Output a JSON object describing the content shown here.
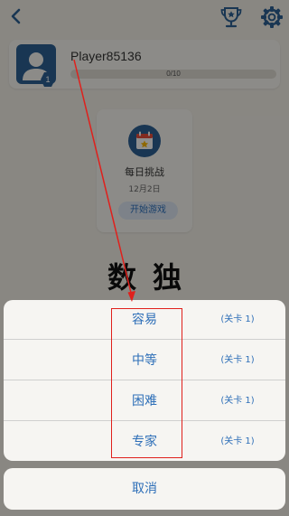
{
  "header": {
    "icons": [
      "back-icon",
      "trophy-icon",
      "gear-icon"
    ],
    "accent_color": "#2C5E8F"
  },
  "player": {
    "name": "Player85136",
    "level": "1",
    "progress_text": "0/10",
    "progress_fraction": 0
  },
  "daily_challenge": {
    "title": "每日挑战",
    "date": "12月2日",
    "start_label": "开始游戏"
  },
  "logo": {
    "title": "数独"
  },
  "difficulty_sheet": {
    "options": [
      {
        "label": "容易",
        "level": "(关卡 1)"
      },
      {
        "label": "中等",
        "level": "(关卡 1)"
      },
      {
        "label": "困难",
        "level": "(关卡 1)"
      },
      {
        "label": "专家",
        "level": "(关卡 1)"
      }
    ],
    "cancel_label": "取消",
    "text_color": "#2E6FB8"
  },
  "annotation": {
    "color": "#E0201C"
  }
}
